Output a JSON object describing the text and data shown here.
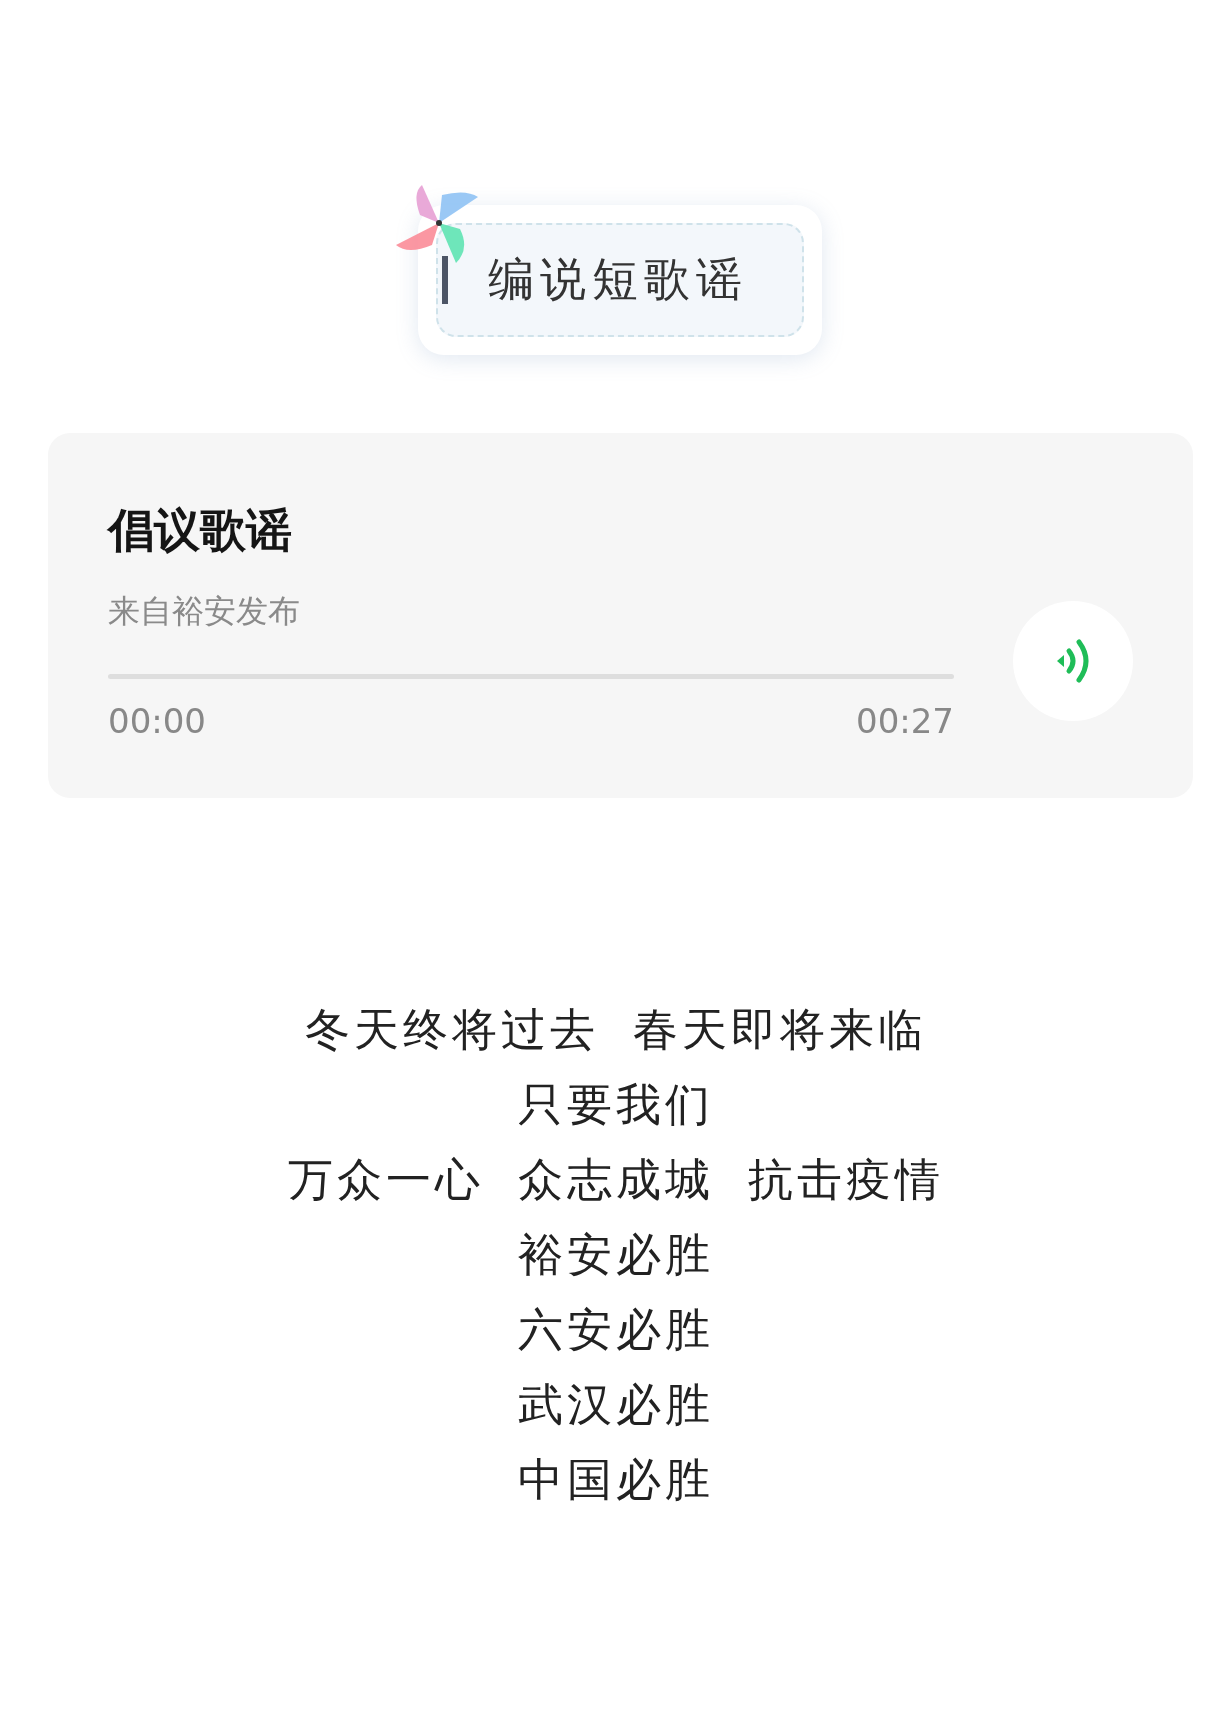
{
  "header": {
    "title": "编说短歌谣"
  },
  "audio": {
    "title": "倡议歌谣",
    "source": "来自裕安发布",
    "level": 0,
    "elapsed": "00:00",
    "duration": "00:27"
  },
  "lyrics": [
    {
      "segments": [
        "冬天终将过去",
        "春天即将来临"
      ]
    },
    {
      "segments": [
        "只要我们"
      ]
    },
    {
      "segments": [
        "万众一心",
        "众志成城",
        "抗击疫情"
      ]
    },
    {
      "segments": [
        "裕安必胜"
      ]
    },
    {
      "segments": [
        "六安必胜"
      ]
    },
    {
      "segments": [
        "武汉必胜"
      ]
    },
    {
      "segments": [
        "中国必胜"
      ]
    }
  ]
}
